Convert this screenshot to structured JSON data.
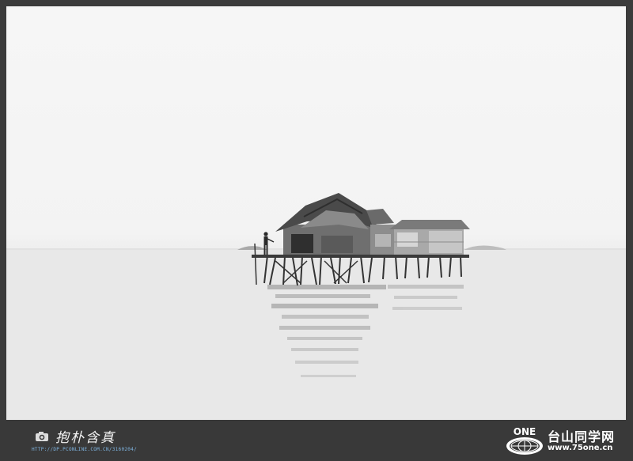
{
  "photo": {
    "subject": "stilt-house-on-water",
    "palette": {
      "sky": "#f5f5f5",
      "water": "#e9e9e9",
      "structure": "#3a3a3a",
      "frame": "#3b3b3b"
    }
  },
  "watermark_left": {
    "signature": "抱朴含真",
    "url": "HTTP://DP.PCONLINE.COM.CN/3160204/",
    "icon": "camera-icon"
  },
  "watermark_right": {
    "logo_text": "ONE",
    "site_name": "台山同学网",
    "site_url": "www.75one.cn",
    "icon": "globe-icon"
  }
}
